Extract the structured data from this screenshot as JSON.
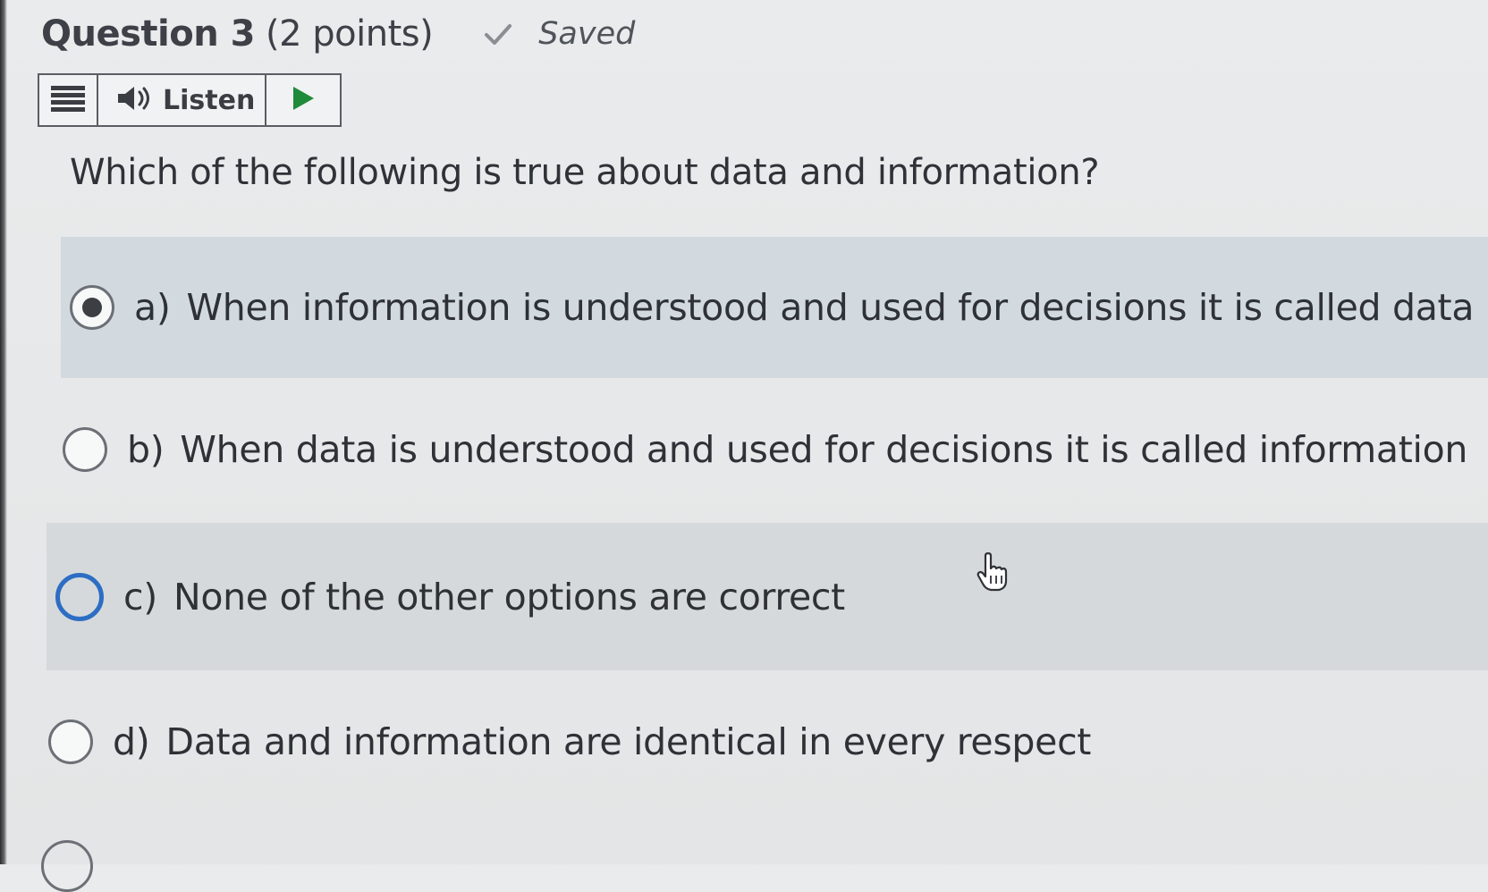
{
  "question": {
    "title": "Question 3",
    "points": "(2 points)",
    "status": "Saved",
    "prompt": "Which of the following is true about data and information?"
  },
  "toolbar": {
    "listen_label": "Listen",
    "menu_icon": "hamburger-menu-icon",
    "speaker_icon": "speaker-icon",
    "play_icon": "play-icon"
  },
  "options": [
    {
      "letter": "a)",
      "text": "When information is understood and used for decisions it is called data",
      "selected": true
    },
    {
      "letter": "b)",
      "text": "When data is understood and used for decisions it is called information",
      "selected": false
    },
    {
      "letter": "c)",
      "text": "None of the other options are correct",
      "selected": false,
      "focused": true
    },
    {
      "letter": "d)",
      "text": "Data and information are identical in every respect",
      "selected": false
    }
  ],
  "colors": {
    "focus_ring": "#2d6ec4",
    "selected_row": "#d2dae0",
    "hover_row": "#d6d9db"
  }
}
